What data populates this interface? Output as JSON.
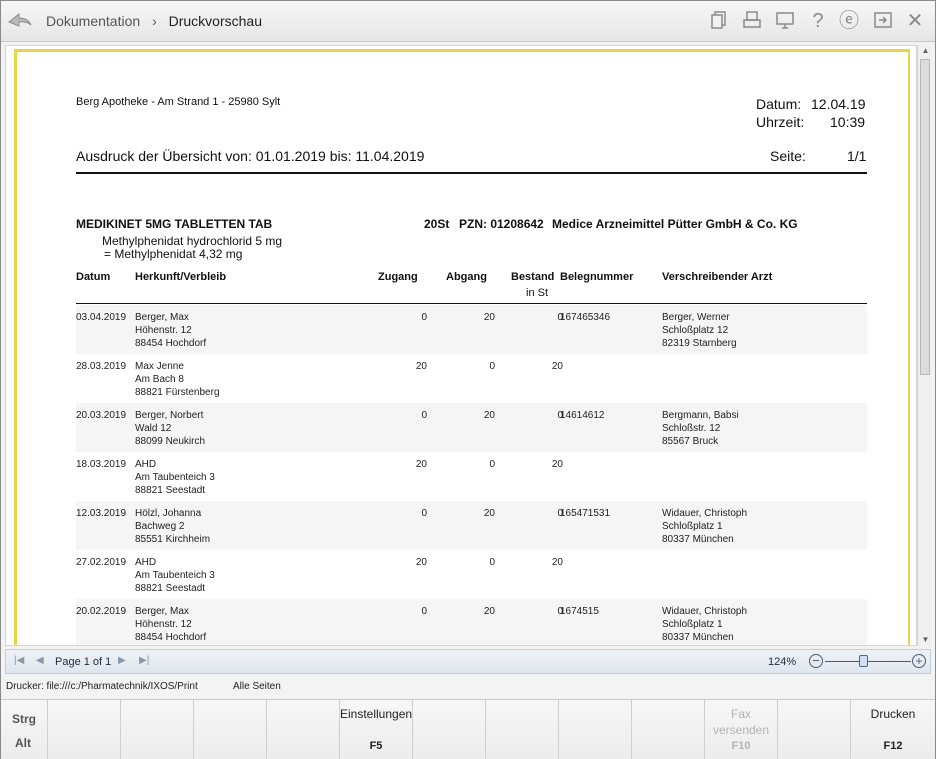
{
  "titlebar": {
    "crumb_parent": "Dokumentation",
    "crumb_separator": "›",
    "crumb_current": "Druckvorschau",
    "icons": [
      "copy-icon",
      "printer-icon",
      "monitor-icon",
      "help-icon",
      "e-icon",
      "export-icon",
      "close-icon"
    ],
    "help_glyph": "?",
    "close_glyph": "✕",
    "e_glyph": "ⓔ"
  },
  "report": {
    "pharmacy_line": "Berg Apotheke - Am Strand 1 - 25980 Sylt",
    "datum_label": "Datum:",
    "datum_value": "12.04.19",
    "uhrzeit_label": "Uhrzeit:",
    "uhrzeit_value": "10:39",
    "overview_title": "Ausdruck der Übersicht von: 01.01.2019 bis: 11.04.2019",
    "seite_label": "Seite:",
    "seite_value": "1/1",
    "product": {
      "name": "MEDIKINET 5MG TABLETTEN  TAB",
      "package": "20St",
      "pzn": "PZN: 01208642",
      "manufacturer": "Medice Arzneimittel Pütter GmbH & Co. KG",
      "ingredient": "Methylphenidat hydrochlorid 5 mg",
      "equivalent": "= Methylphenidat 4,32 mg"
    },
    "columns": {
      "datum": "Datum",
      "herkunft": "Herkunft/Verbleib",
      "zugang": "Zugang",
      "abgang": "Abgang",
      "bestand": "Bestand",
      "bestand_unit": "in St",
      "belegnummer": "Belegnummer",
      "arzt": "Verschreibender Arzt"
    },
    "rows": [
      {
        "date": "03.04.2019",
        "origin": [
          "Berger, Max",
          "Höhenstr. 12",
          "88454 Hochdorf"
        ],
        "zugang": "0",
        "abgang": "20",
        "bestand": "0",
        "beleg": "167465346",
        "arzt": [
          "Berger, Werner",
          "Schloßplatz 12",
          "82319 Starnberg"
        ]
      },
      {
        "date": "28.03.2019",
        "origin": [
          "Max Jenne",
          "Am Bach 8",
          "88821 Fürstenberg"
        ],
        "zugang": "20",
        "abgang": "0",
        "bestand": "20",
        "beleg": "",
        "arzt": [
          "",
          "",
          ""
        ]
      },
      {
        "date": "20.03.2019",
        "origin": [
          "Berger, Norbert",
          "Wald 12",
          "88099 Neukirch"
        ],
        "zugang": "0",
        "abgang": "20",
        "bestand": "0",
        "beleg": "14614612",
        "arzt": [
          "Bergmann, Babsi",
          "Schloßstr. 12",
          "85567 Bruck"
        ]
      },
      {
        "date": "18.03.2019",
        "origin": [
          "AHD",
          "Am Taubenteich 3",
          "88821 Seestadt"
        ],
        "zugang": "20",
        "abgang": "0",
        "bestand": "20",
        "beleg": "",
        "arzt": [
          "",
          "",
          ""
        ]
      },
      {
        "date": "12.03.2019",
        "origin": [
          "Hölzl, Johanna",
          "Bachweg 2",
          "85551 Kirchheim"
        ],
        "zugang": "0",
        "abgang": "20",
        "bestand": "0",
        "beleg": "165471531",
        "arzt": [
          "Widauer, Christoph",
          "Schloßplatz 1",
          "80337 München"
        ]
      },
      {
        "date": "27.02.2019",
        "origin": [
          "AHD",
          "Am Taubenteich 3",
          "88821 Seestadt"
        ],
        "zugang": "20",
        "abgang": "0",
        "bestand": "20",
        "beleg": "",
        "arzt": [
          "",
          "",
          ""
        ]
      },
      {
        "date": "20.02.2019",
        "origin": [
          "Berger, Max",
          "Höhenstr. 12",
          "88454 Hochdorf"
        ],
        "zugang": "0",
        "abgang": "20",
        "bestand": "0",
        "beleg": "1674515",
        "arzt": [
          "Widauer, Christoph",
          "Schloßplatz 1",
          "80337 München"
        ]
      }
    ]
  },
  "pager": {
    "page_label": "Page 1 of 1",
    "zoom_text": "124%",
    "zoom_minus": "−",
    "zoom_plus": "+",
    "zoom_level": 0.45
  },
  "status": {
    "printer": "Drucker: file:///c:/Pharmatechnik/IXOS/Print",
    "pages": "Alle Seiten"
  },
  "fkeys": {
    "mod_strg": "Strg",
    "mod_alt": "Alt",
    "einstellungen_label": "Einstellungen",
    "einstellungen_key": "F5",
    "fax_label_1": "Fax",
    "fax_label_2": "versenden",
    "fax_key": "F10",
    "drucken_label": "Drucken",
    "drucken_key": "F12"
  },
  "colors": {
    "page_border": "#e8d64a",
    "row_shade": "#f5f5f5",
    "pager_bg": "#dfe6ee"
  }
}
